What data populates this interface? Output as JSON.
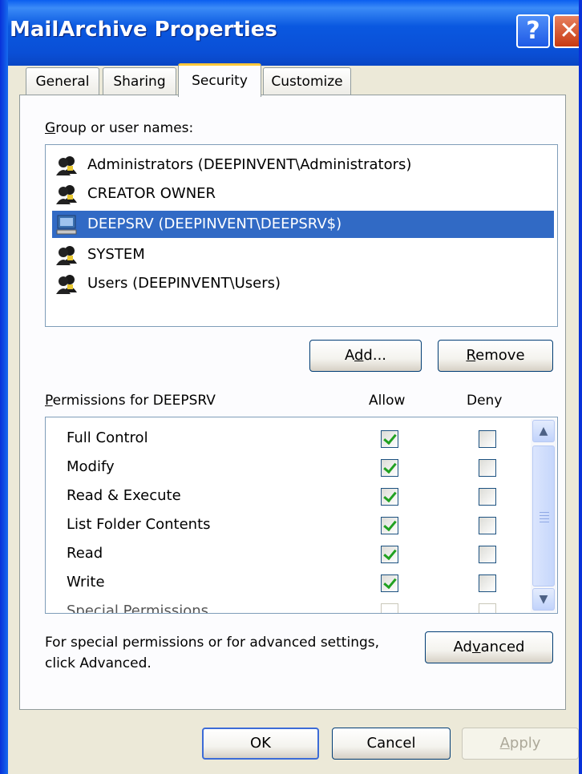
{
  "window": {
    "title": "MailArchive Properties",
    "help_label": "?",
    "close_label": "✕",
    "title_color": "#0a58e0"
  },
  "tabs": [
    {
      "label": "General"
    },
    {
      "label": "Sharing"
    },
    {
      "label": "Security",
      "active": true
    },
    {
      "label": "Customize"
    }
  ],
  "security": {
    "group_label_accel": "G",
    "group_label_rest": "roup or user names:",
    "users": [
      {
        "name": "Administrators (DEEPINVENT\\Administrators)",
        "icon": "users-group-icon"
      },
      {
        "name": "CREATOR OWNER",
        "icon": "users-group-icon"
      },
      {
        "name": "DEEPSRV (DEEPINVENT\\DEEPSRV$)",
        "icon": "computer-icon",
        "selected": true
      },
      {
        "name": "SYSTEM",
        "icon": "users-group-icon"
      },
      {
        "name": "Users (DEEPINVENT\\Users)",
        "icon": "users-group-icon"
      }
    ],
    "add_pre": "A",
    "add_accel": "d",
    "add_post": "d...",
    "remove_accel": "R",
    "remove_rest": "emove",
    "perm_label_accel": "P",
    "perm_label_rest": "ermissions for DEEPSRV",
    "allow_header": "Allow",
    "deny_header": "Deny",
    "permissions": [
      {
        "name": "Full Control",
        "allow": true,
        "deny": false
      },
      {
        "name": "Modify",
        "allow": true,
        "deny": false
      },
      {
        "name": "Read & Execute",
        "allow": true,
        "deny": false
      },
      {
        "name": "List Folder Contents",
        "allow": true,
        "deny": false
      },
      {
        "name": "Read",
        "allow": true,
        "deny": false
      },
      {
        "name": "Write",
        "allow": true,
        "deny": false
      },
      {
        "name": "Special Permissions",
        "allow": false,
        "deny": false
      }
    ],
    "advanced_note_line1": "For special permissions or for advanced settings,",
    "advanced_note_line2": "click Advanced.",
    "advanced_pre": "Ad",
    "advanced_accel": "v",
    "advanced_post": "anced"
  },
  "footer": {
    "ok_label": "OK",
    "cancel_label": "Cancel",
    "apply_accel": "A",
    "apply_rest": "pply"
  },
  "colors": {
    "selection": "#316ac5",
    "check": "#21a121",
    "dialog_bg": "#ece9d8"
  }
}
